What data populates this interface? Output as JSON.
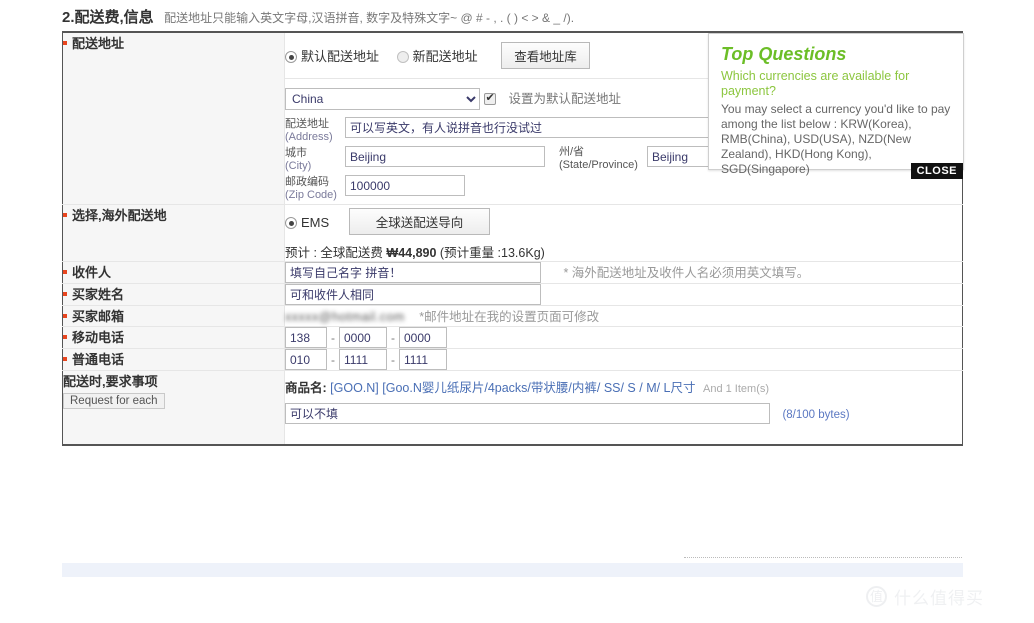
{
  "section": {
    "number_title": "2.配送费,信息",
    "note": "配送地址只能输入英文字母,汉语拼音, 数字及特殊文字~ @ # - , . ( ) < > & _ /)."
  },
  "rows": {
    "shipping_address": {
      "label": "配送地址",
      "radio_default_label": "默认配送地址",
      "radio_new_label": "新配送地址",
      "address_book_button": "查看地址库",
      "country_selected": "China",
      "set_default_checkbox_label": "设置为默认配送地址",
      "address_label_cn": "配送地址",
      "address_label_en": "(Address)",
      "address_value": "可以写英文，有人说拼音也行没试过",
      "city_label_cn": "城市",
      "city_label_en": "(City)",
      "city_value": "Beijing",
      "state_label_cn": "州/省",
      "state_label_en": "(State/Province)",
      "state_value": "Beijing",
      "zip_label_cn": "邮政编码",
      "zip_label_en": "(Zip Code)",
      "zip_value": "100000"
    },
    "overseas_shipping": {
      "label": "选择,海外配送地",
      "carrier_label": "EMS",
      "guide_button": "全球送配送导向",
      "estimate_prefix": "预计 : 全球配送费",
      "estimate_amount": "₩44,890",
      "estimate_weight": "(预计重量 :13.6Kg)"
    },
    "recipient": {
      "label": "收件人",
      "value": "填写自己名字 拼音！",
      "note": "* 海外配送地址及收件人名必须用英文填写。"
    },
    "buyer_name": {
      "label": "买家姓名",
      "value": "可和收件人相同"
    },
    "buyer_email": {
      "label": "买家邮箱",
      "value_masked": "xxxxx@hotmail.com",
      "note": "*邮件地址在我的设置页面可修改"
    },
    "mobile_phone": {
      "label": "移动电话",
      "part1": "138",
      "part2": "0000",
      "part3": "0000",
      "separator": "-"
    },
    "landline_phone": {
      "label": "普通电话",
      "part1": "010",
      "part2": "1111",
      "part3": "1111",
      "separator": "-"
    },
    "request": {
      "label": "配送时,要求事项",
      "sub_label": "Request for each",
      "product_key": "商品名:",
      "product_name": "[GOO.N] [Goo.N婴儿纸尿片/4packs/带状腰/内裤/ SS/ S / M/ L尺寸",
      "item_count": "And 1 Item(s)",
      "request_value": "可以不填",
      "bytes_counter": "(8/100 bytes)"
    }
  },
  "top_questions": {
    "title": "Top Questions",
    "question": "Which currencies are available for payment?",
    "answer": "You may select a currency you'd like to pay among the list below : KRW(Korea), RMB(China), USD(USA), NZD(New Zealand), HKD(Hong Kong), SGD(Singapore)",
    "close_label": "CLOSE"
  },
  "watermark": {
    "badge": "值",
    "text": "什么值得买"
  },
  "colors": {
    "accent_green": "#6cbe27",
    "question_green": "#8cc63f",
    "required_dot": "#e8451f",
    "link_blue": "#4a6fb5",
    "byte_blue": "#5b78c2"
  }
}
